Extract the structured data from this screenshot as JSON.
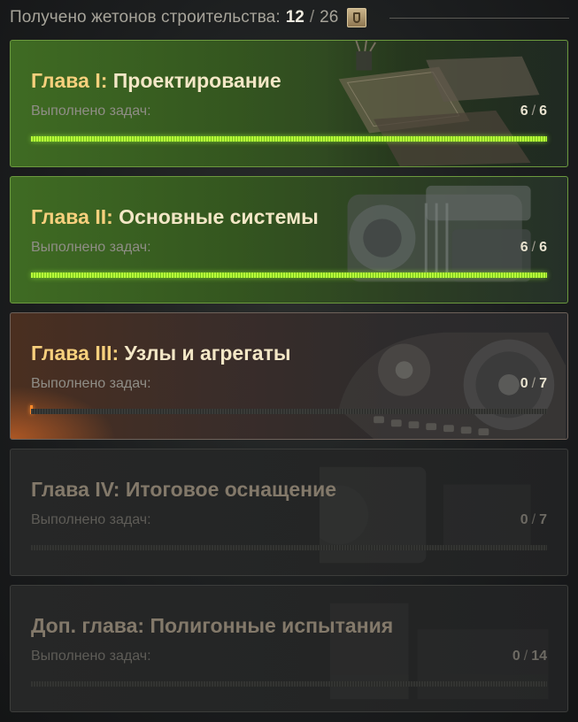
{
  "header": {
    "label": "Получено жетонов строительства:",
    "tokens_current": "12",
    "separator": "/",
    "tokens_total": "26",
    "token_icon": "construction-token-icon"
  },
  "chapters": [
    {
      "num": "Глава I:",
      "name": "Проектирование",
      "tasks_label": "Выполнено задач:",
      "done": "6",
      "total": "6",
      "progress": 1.0,
      "state": "completed",
      "art": "blueprints-desk"
    },
    {
      "num": "Глава II:",
      "name": "Основные системы",
      "tasks_label": "Выполнено задач:",
      "done": "6",
      "total": "6",
      "progress": 1.0,
      "state": "completed",
      "art": "engine"
    },
    {
      "num": "Глава III:",
      "name": "Узлы и агрегаты",
      "tasks_label": "Выполнено задач:",
      "done": "0",
      "total": "7",
      "progress": 0.0,
      "state": "active",
      "art": "tank-tracks"
    },
    {
      "num": "Глава IV:",
      "name": "Итоговое оснащение",
      "tasks_label": "Выполнено задач:",
      "done": "0",
      "total": "7",
      "progress": 0.0,
      "state": "locked",
      "art": "equipment"
    },
    {
      "num": "Доп. глава:",
      "name": "Полигонные испытания",
      "tasks_label": "Выполнено задач:",
      "done": "0",
      "total": "14",
      "progress": 0.0,
      "state": "locked",
      "art": "proving-ground"
    }
  ],
  "colors": {
    "completed_accent": "#b7ff3a",
    "active_accent": "#ff8a2a",
    "title_number": "#f7d07d"
  }
}
